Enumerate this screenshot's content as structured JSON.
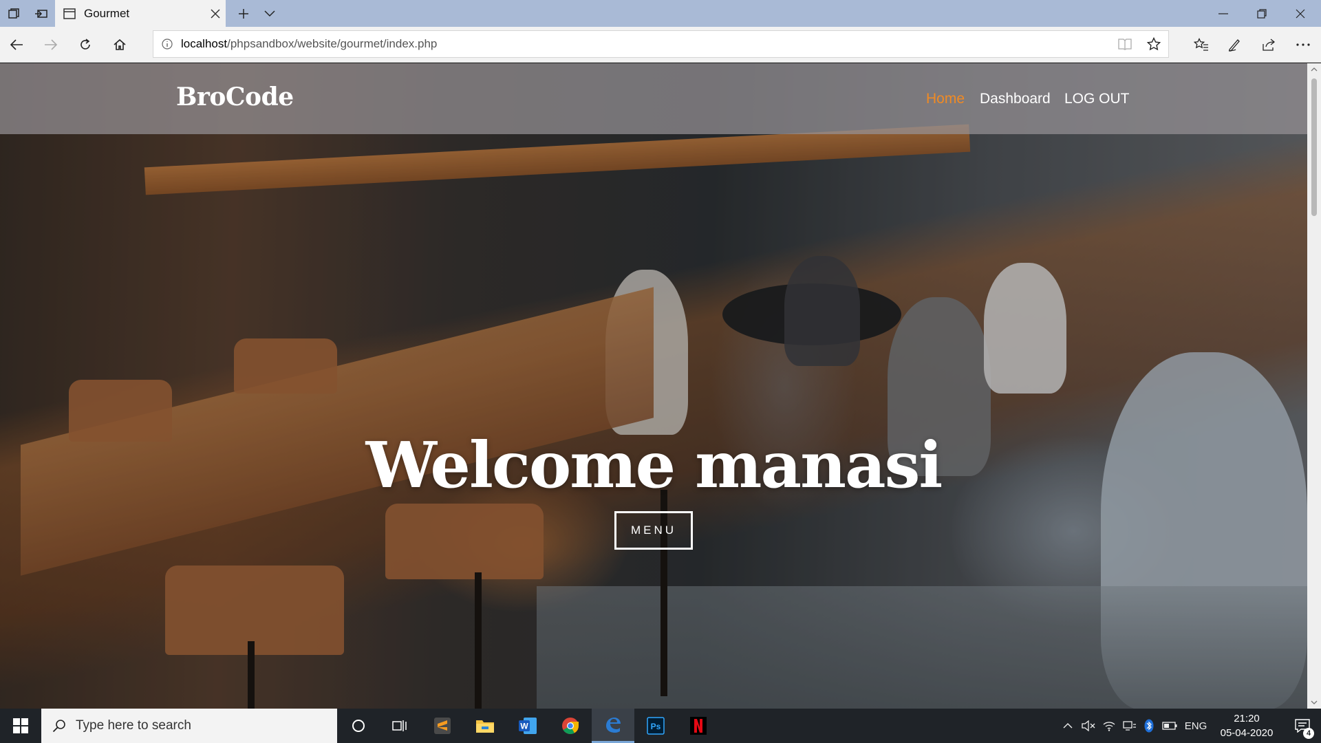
{
  "browser": {
    "tab_title": "Gourmet",
    "url_host": "localhost",
    "url_path": "/phpsandbox/website/gourmet/index.php"
  },
  "site": {
    "brand": "BroCode",
    "nav": [
      {
        "label": "Home",
        "active": true
      },
      {
        "label": "Dashboard",
        "active": false
      },
      {
        "label": "LOG OUT",
        "active": false
      }
    ],
    "hero_title": "Welcome manasi",
    "hero_button": "MENU",
    "accent_color": "#f08a24"
  },
  "taskbar": {
    "search_placeholder": "Type here to search",
    "pinned_apps": [
      "cortana-icon",
      "task-view-icon",
      "sublime-text-icon",
      "file-explorer-icon",
      "word-icon",
      "chrome-icon",
      "edge-icon",
      "photoshop-icon",
      "netflix-icon"
    ],
    "language": "ENG",
    "time": "21:20",
    "date": "05-04-2020",
    "notification_count": "4"
  }
}
